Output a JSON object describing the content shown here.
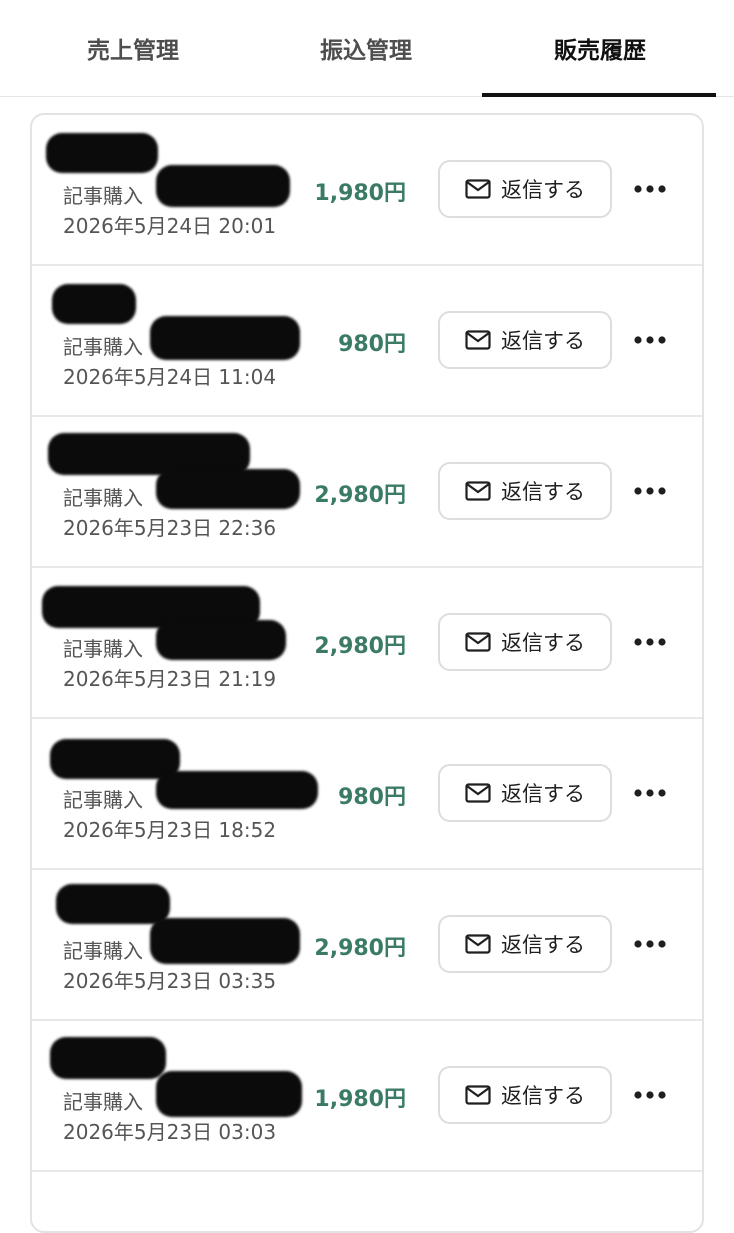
{
  "tabs": [
    {
      "label": "売上管理",
      "active": false
    },
    {
      "label": "振込管理",
      "active": false
    },
    {
      "label": "販売履歴",
      "active": true
    }
  ],
  "accent_color": "#3b7b66",
  "sales": [
    {
      "kind": "記事購入",
      "datetime": "2026年5月24日 20:01",
      "price": "1,980円",
      "reply_label": "返信する"
    },
    {
      "kind": "記事購入",
      "datetime": "2026年5月24日 11:04",
      "price": "980円",
      "reply_label": "返信する"
    },
    {
      "kind": "記事購入",
      "datetime": "2026年5月23日 22:36",
      "price": "2,980円",
      "reply_label": "返信する"
    },
    {
      "kind": "記事購入",
      "datetime": "2026年5月23日 21:19",
      "price": "2,980円",
      "reply_label": "返信する"
    },
    {
      "kind": "記事購入",
      "datetime": "2026年5月23日 18:52",
      "price": "980円",
      "reply_label": "返信する"
    },
    {
      "kind": "記事購入",
      "datetime": "2026年5月23日 03:35",
      "price": "2,980円",
      "reply_label": "返信する"
    },
    {
      "kind": "記事購入",
      "datetime": "2026年5月23日 03:03",
      "price": "1,980円",
      "reply_label": "返信する"
    }
  ]
}
